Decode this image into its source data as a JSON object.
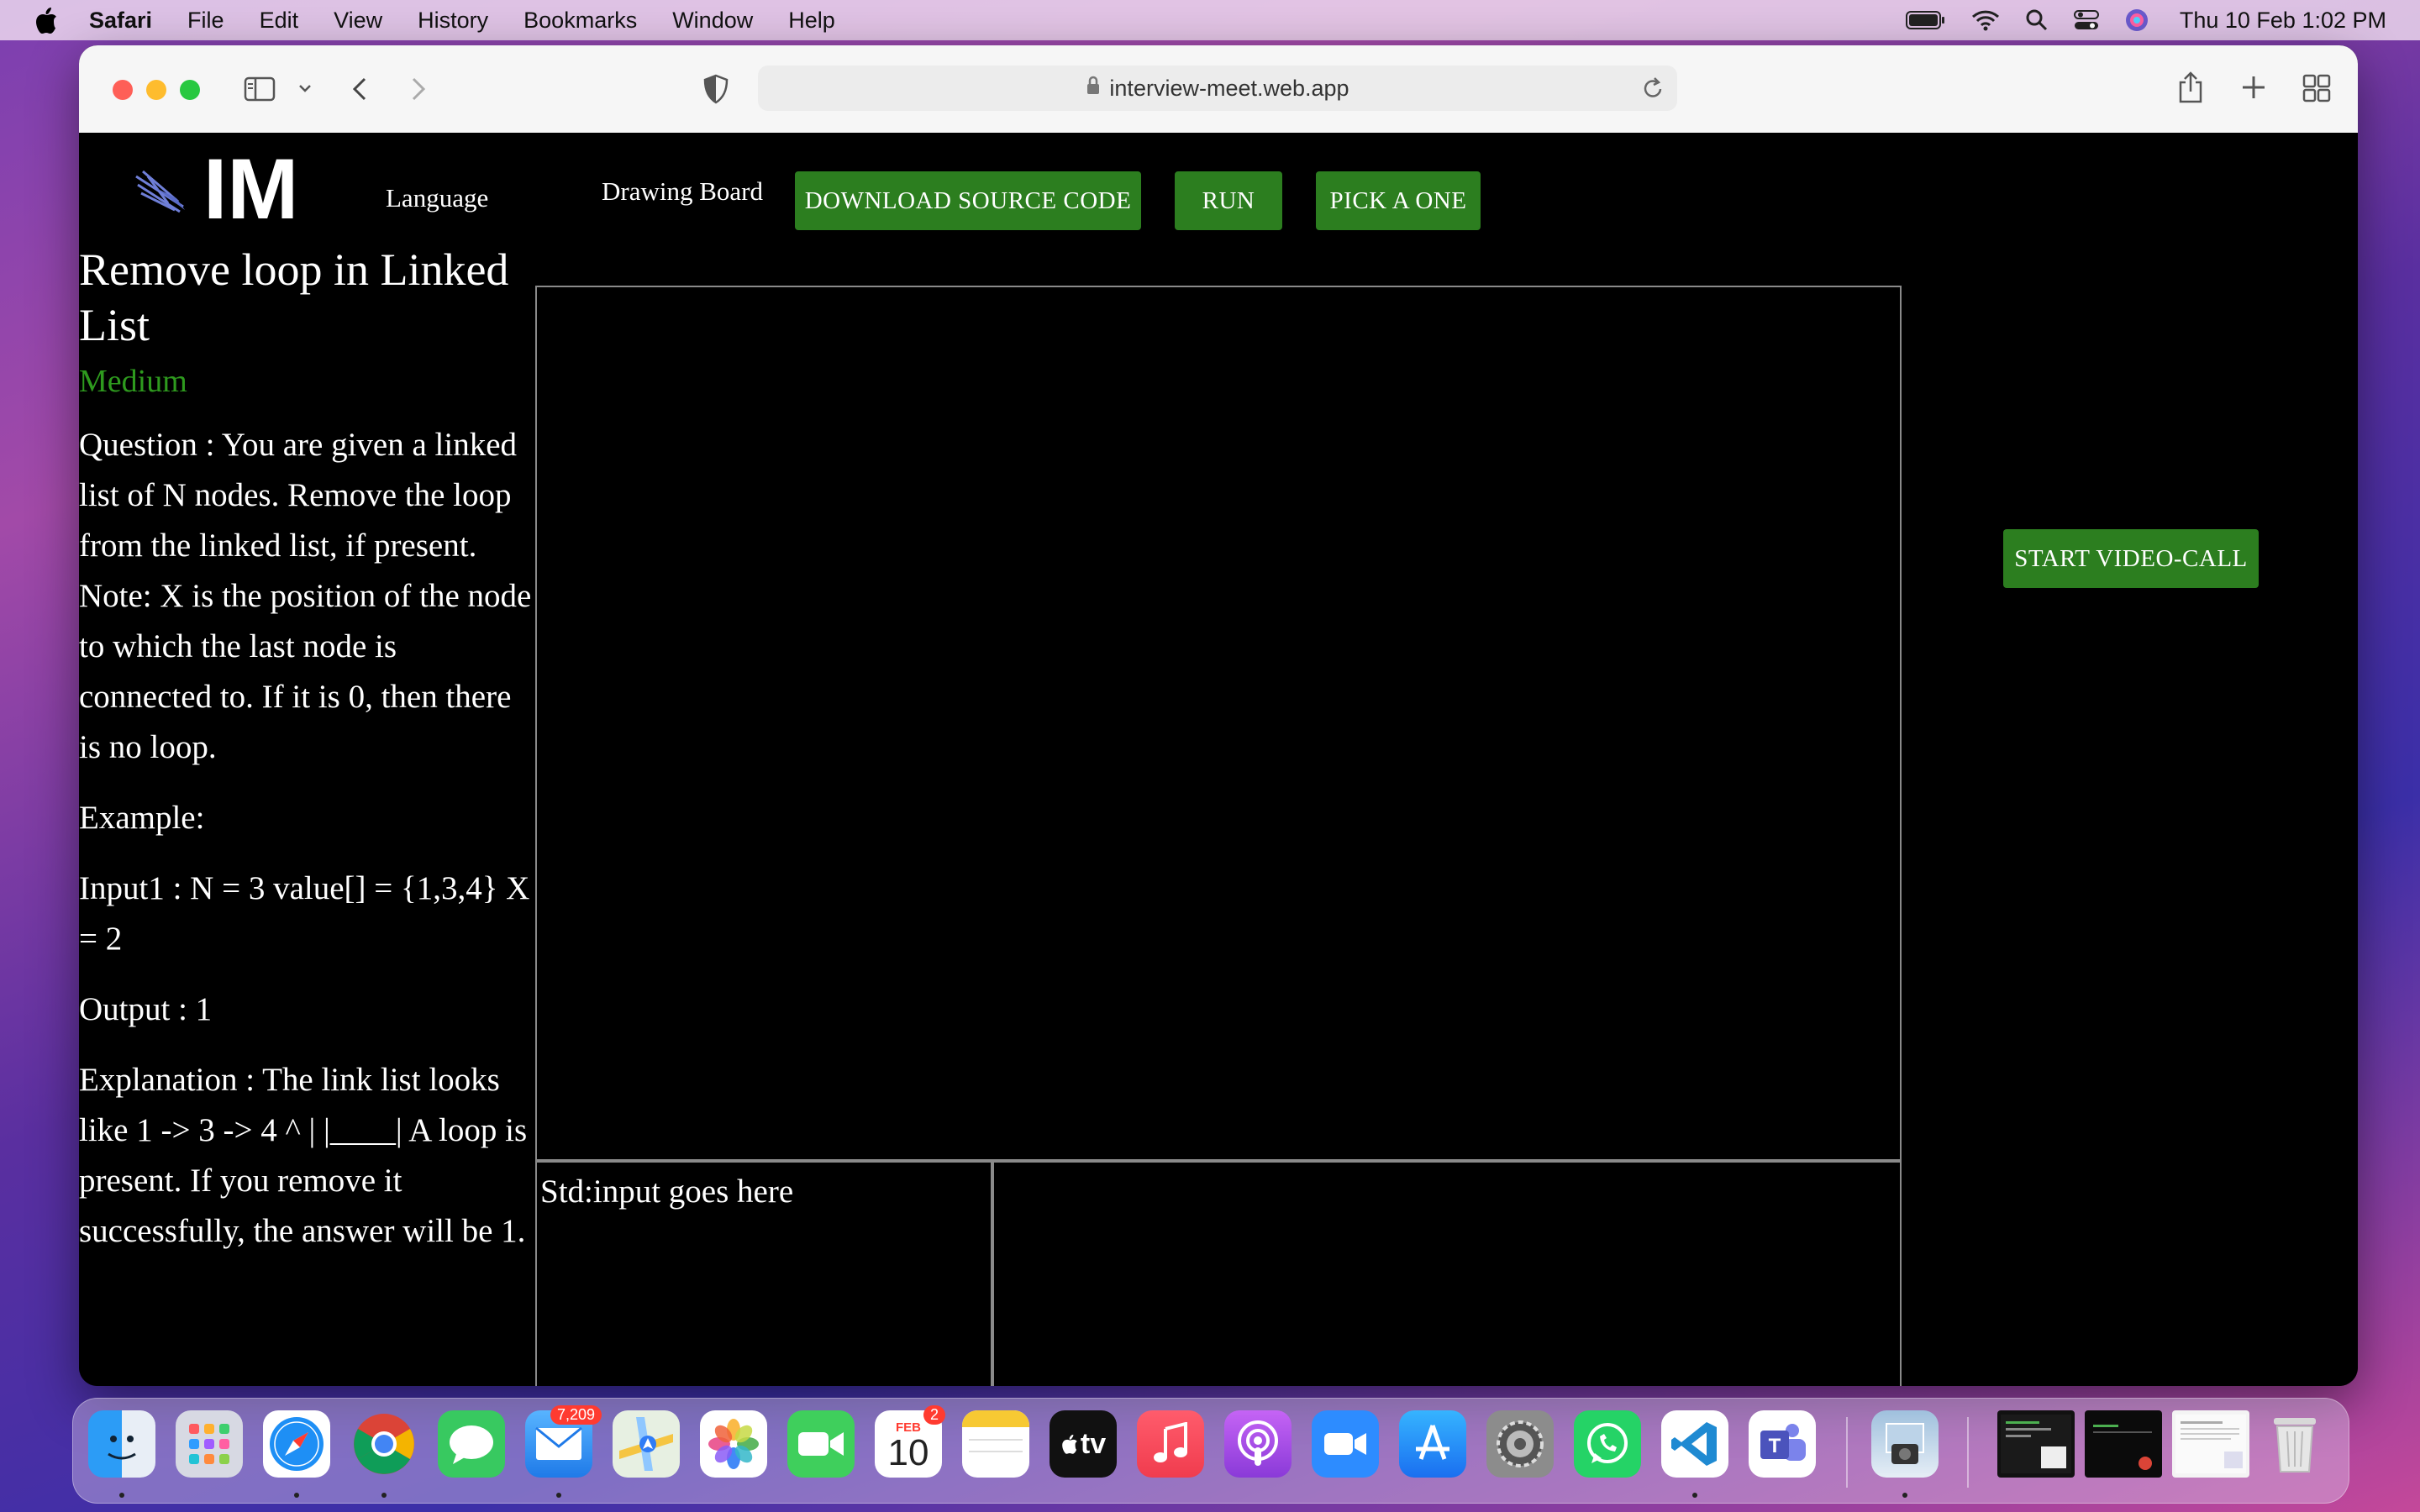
{
  "menubar": {
    "app_name": "Safari",
    "menus": [
      "File",
      "Edit",
      "View",
      "History",
      "Bookmarks",
      "Window",
      "Help"
    ],
    "clock": "Thu 10 Feb  1:02 PM"
  },
  "browser": {
    "url": "interview-meet.web.app"
  },
  "page": {
    "logo_text": "IM",
    "language_label": "Language",
    "drawing_board": "Drawing Board",
    "download_button": "DOWNLOAD SOURCE CODE",
    "run_button": "RUN",
    "pick_button": "PICK A ONE",
    "video_button": "START VIDEO-CALL",
    "problem": {
      "title": "Remove loop in Linked List",
      "difficulty": "Medium",
      "question": "Question : You are given a linked list of N nodes. Remove the loop from the linked list, if present. Note: X is the position of the node to which the last node is connected to. If it is 0, then there is no loop.",
      "example_label": "Example:",
      "input": "Input1 : N = 3 value[] = {1,3,4} X = 2",
      "output": "Output : 1",
      "explanation": "Explanation : The link list looks like 1 -> 3 -> 4 ^ | |____| A loop is present. If you remove it successfully, the answer will be 1."
    },
    "stdin_placeholder": "Std:input goes here"
  },
  "dock": {
    "mail_badge": "7,209",
    "calendar_month": "FEB",
    "calendar_day": "10",
    "calendar_badge": "2",
    "tv_label": "tv"
  },
  "colors": {
    "accent_green": "#2c7e1f",
    "difficulty_green": "#2e9a1e"
  }
}
